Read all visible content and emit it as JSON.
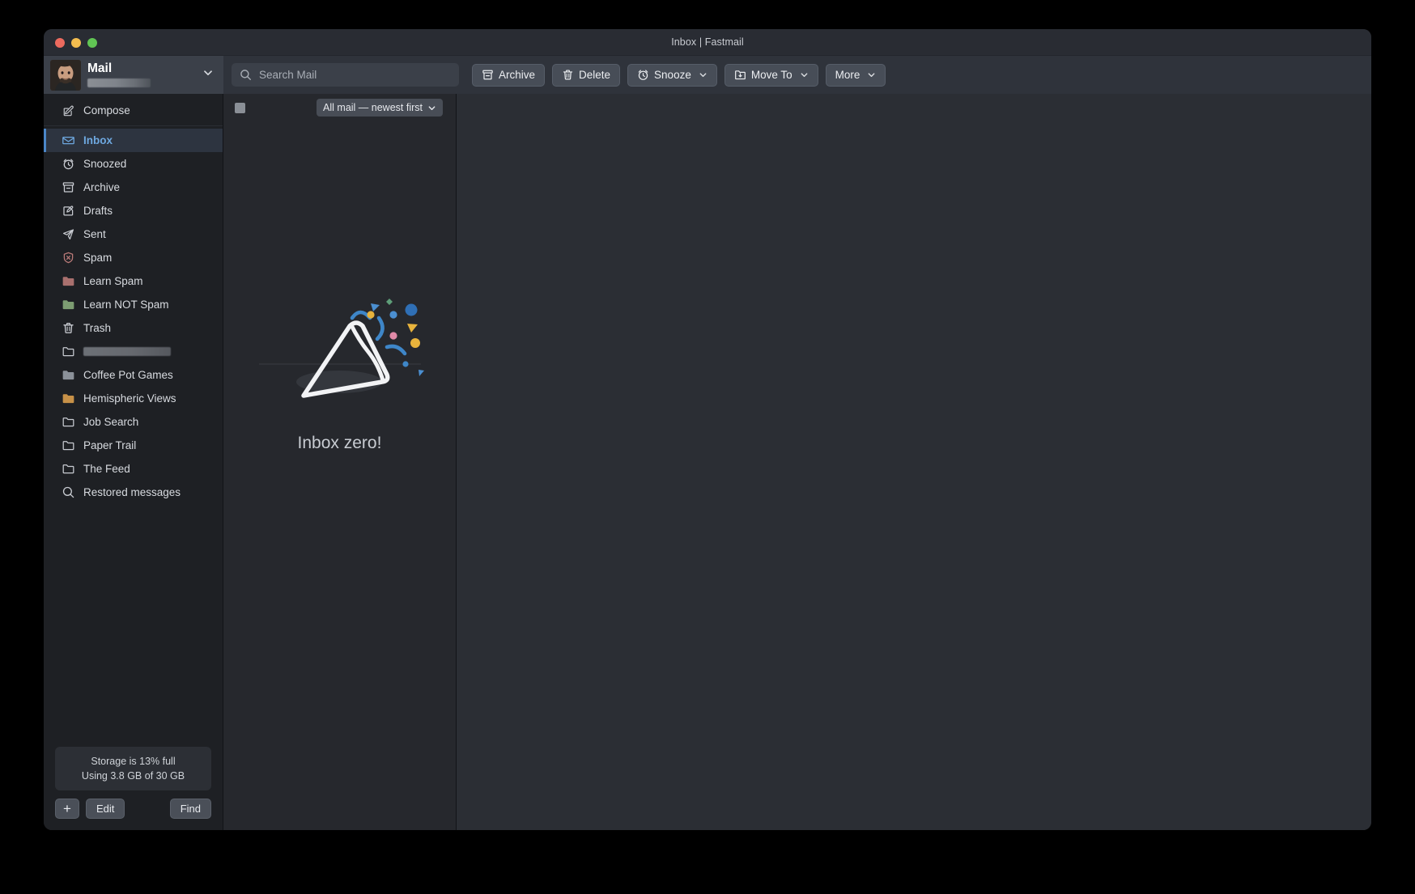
{
  "window": {
    "title": "Inbox | Fastmail",
    "traffic_lights": [
      "close",
      "minimize",
      "zoom"
    ]
  },
  "account": {
    "name": "Mail",
    "email_redacted": true,
    "chevron_icon": "chevron-down-icon",
    "avatar_icon": "avatar"
  },
  "search": {
    "placeholder": "Search Mail",
    "icon": "search-icon"
  },
  "toolbar": {
    "buttons": [
      {
        "label": "Archive",
        "icon": "archive-icon",
        "dropdown": false
      },
      {
        "label": "Delete",
        "icon": "trash-icon",
        "dropdown": false
      },
      {
        "label": "Snooze",
        "icon": "clock-icon",
        "dropdown": true
      },
      {
        "label": "Move To",
        "icon": "move-to-icon",
        "dropdown": true
      },
      {
        "label": "More",
        "icon": "",
        "dropdown": true
      }
    ]
  },
  "sidebar": {
    "compose": {
      "label": "Compose",
      "icon": "compose-icon"
    },
    "items": [
      {
        "label": "Inbox",
        "icon": "inbox-icon",
        "selected": true,
        "color": "#6ea8e0",
        "redacted": false
      },
      {
        "label": "Snoozed",
        "icon": "clock-icon",
        "selected": false,
        "color": "#c9ccd2",
        "redacted": false
      },
      {
        "label": "Archive",
        "icon": "archive-icon",
        "selected": false,
        "color": "#c9ccd2",
        "redacted": false
      },
      {
        "label": "Drafts",
        "icon": "drafts-icon",
        "selected": false,
        "color": "#c9ccd2",
        "redacted": false
      },
      {
        "label": "Sent",
        "icon": "sent-icon",
        "selected": false,
        "color": "#c9ccd2",
        "redacted": false
      },
      {
        "label": "Spam",
        "icon": "spam-shield-icon",
        "selected": false,
        "color": "#b97a78",
        "redacted": false
      },
      {
        "label": "Learn Spam",
        "icon": "folder-filled-icon",
        "selected": false,
        "color": "#a9706e",
        "redacted": false
      },
      {
        "label": "Learn NOT Spam",
        "icon": "folder-filled-icon",
        "selected": false,
        "color": "#7d9d72",
        "redacted": false
      },
      {
        "label": "Trash",
        "icon": "trash-icon",
        "selected": false,
        "color": "#c9ccd2",
        "redacted": false
      },
      {
        "label": "",
        "icon": "folder-icon",
        "selected": false,
        "color": "#c9ccd2",
        "redacted": true
      },
      {
        "label": "Coffee Pot Games",
        "icon": "folder-filled-icon",
        "selected": false,
        "color": "#8b9199",
        "redacted": false
      },
      {
        "label": "Hemispheric Views",
        "icon": "folder-filled-icon",
        "selected": false,
        "color": "#c79148",
        "redacted": false
      },
      {
        "label": "Job Search",
        "icon": "folder-icon",
        "selected": false,
        "color": "#c9ccd2",
        "redacted": false
      },
      {
        "label": "Paper Trail",
        "icon": "folder-icon",
        "selected": false,
        "color": "#c9ccd2",
        "redacted": false
      },
      {
        "label": "The Feed",
        "icon": "folder-icon",
        "selected": false,
        "color": "#c9ccd2",
        "redacted": false
      },
      {
        "label": "Restored messages",
        "icon": "search-icon",
        "selected": false,
        "color": "#c9ccd2",
        "redacted": false
      }
    ],
    "storage": {
      "line1": "Storage is 13% full",
      "line2": "Using 3.8 GB of 30 GB",
      "percent": 13,
      "used": "3.8 GB",
      "total": "30 GB"
    },
    "buttons": {
      "add": "+",
      "edit": "Edit",
      "find": "Find"
    }
  },
  "message_list": {
    "select_all_checkbox": "partially-selected",
    "sort": {
      "label": "All mail — newest first",
      "chevron_icon": "chevron-down-icon"
    },
    "empty_state": {
      "label": "Inbox zero!",
      "illustration": "party-popper-confetti"
    },
    "messages": []
  },
  "colors": {
    "accent": "#6ea8e0",
    "window_bg": "#2a2d34",
    "sidebar_bg": "#1e2024",
    "list_bg": "#26282d",
    "read_bg": "#2b2e34",
    "toolbar_bg": "#2f333b"
  }
}
